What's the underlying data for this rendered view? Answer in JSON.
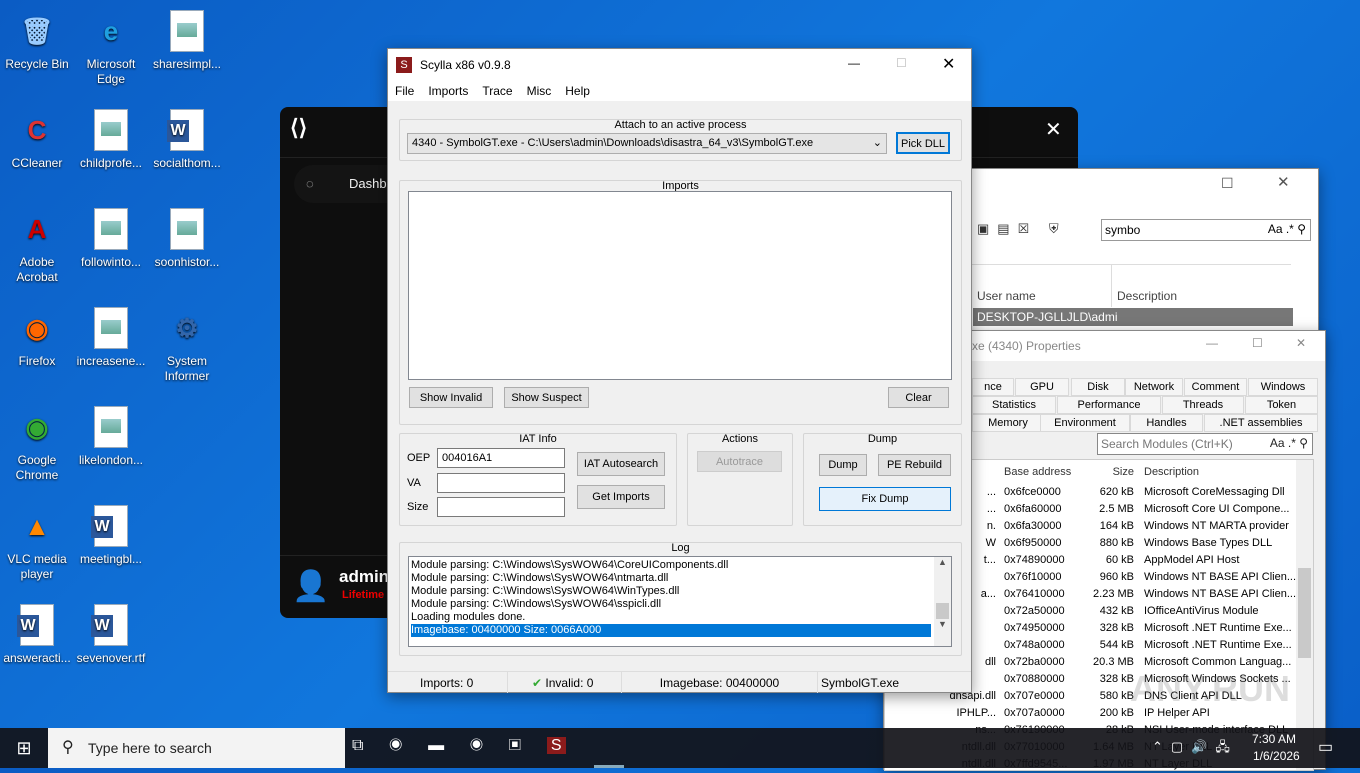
{
  "desktop": {
    "icons": [
      {
        "label": "Recycle Bin",
        "glyph": "🗑"
      },
      {
        "label": "Microsoft Edge",
        "glyph": "e"
      },
      {
        "label": "sharesimpl...",
        "glyph": "doc"
      },
      {
        "label": "CCleaner",
        "glyph": "C"
      },
      {
        "label": "childprofe...",
        "glyph": "doc"
      },
      {
        "label": "socialthom...",
        "glyph": "W"
      },
      {
        "label": "Adobe Acrobat",
        "glyph": "A"
      },
      {
        "label": "followinto...",
        "glyph": "doc"
      },
      {
        "label": "soonhistor...",
        "glyph": "doc"
      },
      {
        "label": "Firefox",
        "glyph": "ff"
      },
      {
        "label": "increasene...",
        "glyph": "doc"
      },
      {
        "label": "System Informer",
        "glyph": "⚙"
      },
      {
        "label": "Google Chrome",
        "glyph": "chrome"
      },
      {
        "label": "likelondon...",
        "glyph": "doc"
      },
      {
        "label": "VLC media player",
        "glyph": "vlc"
      },
      {
        "label": "meetingbl...",
        "glyph": "W"
      },
      {
        "label": "answeracti...",
        "glyph": "W"
      },
      {
        "label": "sevenover.rtf",
        "glyph": "W"
      }
    ]
  },
  "dark_app": {
    "nav_item": "Dashb",
    "user": "admin",
    "plan": "Lifetime"
  },
  "search_window": {
    "search_value": "symbo",
    "case_label": "Aa",
    "regex_label": ".*",
    "col_user": "User name",
    "col_desc": "Description",
    "row_user": "DESKTOP-JGLLJLD\\admi"
  },
  "props_window": {
    "title": "xe (4340) Properties",
    "tabs_row1": [
      "nce",
      "GPU",
      "Disk",
      "Network",
      "Comment",
      "Windows"
    ],
    "tabs_row2": [
      "Statistics",
      "Performance",
      "Threads",
      "Token"
    ],
    "tabs_row3": [
      "Memory",
      "Environment",
      "Handles",
      ".NET assemblies"
    ],
    "search_placeholder": "Search Modules (Ctrl+K)",
    "columns": [
      "Base address",
      "Size",
      "Description"
    ],
    "rows": [
      {
        "name": "...",
        "base": "0x6fce0000",
        "size": "620 kB",
        "desc": "Microsoft CoreMessaging Dll"
      },
      {
        "name": "...",
        "base": "0x6fa60000",
        "size": "2.5 MB",
        "desc": "Microsoft Core UI Compone..."
      },
      {
        "name": "n.",
        "base": "0x6fa30000",
        "size": "164 kB",
        "desc": "Windows NT MARTA provider"
      },
      {
        "name": "W",
        "base": "0x6f950000",
        "size": "880 kB",
        "desc": "Windows Base Types DLL"
      },
      {
        "name": "t...",
        "base": "0x74890000",
        "size": "60 kB",
        "desc": "AppModel API Host"
      },
      {
        "name": "",
        "base": "0x76f10000",
        "size": "960 kB",
        "desc": "Windows NT BASE API Clien..."
      },
      {
        "name": "a...",
        "base": "0x76410000",
        "size": "2.23 MB",
        "desc": "Windows NT BASE API Clien..."
      },
      {
        "name": "",
        "base": "0x72a50000",
        "size": "432 kB",
        "desc": "IOfficeAntiVirus Module"
      },
      {
        "name": "",
        "base": "0x74950000",
        "size": "328 kB",
        "desc": "Microsoft .NET Runtime Exe..."
      },
      {
        "name": "",
        "base": "0x748a0000",
        "size": "544 kB",
        "desc": "Microsoft .NET Runtime Exe..."
      },
      {
        "name": "dll",
        "base": "0x72ba0000",
        "size": "20.3 MB",
        "desc": "Microsoft Common Languag..."
      },
      {
        "name": "",
        "base": "0x70880000",
        "size": "328 kB",
        "desc": "Microsoft Windows Sockets ..."
      },
      {
        "name": "dnsapi.dll",
        "base": "0x707e0000",
        "size": "580 kB",
        "desc": "DNS Client API DLL"
      },
      {
        "name": "IPHLP...",
        "base": "0x707a0000",
        "size": "200 kB",
        "desc": "IP Helper API"
      },
      {
        "name": "ns...",
        "base": "0x76190000",
        "size": "28 kB",
        "desc": "NSI User-mode interface DLL"
      },
      {
        "name": "ntdll.dll",
        "base": "0x77010000",
        "size": "1.64 MB",
        "desc": "NT Layer DLL"
      },
      {
        "name": "ntdll.dll",
        "base": "0x7ffd9545...",
        "size": "1.97 MB",
        "desc": "NT Layer DLL"
      }
    ]
  },
  "scylla": {
    "title": "Scylla x86 v0.9.8",
    "menu": [
      "File",
      "Imports",
      "Trace",
      "Misc",
      "Help"
    ],
    "attach_label": "Attach to an active process",
    "process": "4340 - SymbolGT.exe - C:\\Users\\admin\\Downloads\\disastra_64_v3\\SymbolGT.exe",
    "pick_dll": "Pick DLL",
    "imports_label": "Imports",
    "show_invalid": "Show Invalid",
    "show_suspect": "Show Suspect",
    "clear": "Clear",
    "iat_label": "IAT Info",
    "oep_label": "OEP",
    "oep_value": "004016A1",
    "va_label": "VA",
    "size_label": "Size",
    "iat_autosearch": "IAT Autosearch",
    "get_imports": "Get Imports",
    "actions_label": "Actions",
    "autotrace": "Autotrace",
    "dump_label": "Dump",
    "dump": "Dump",
    "pe_rebuild": "PE Rebuild",
    "fix_dump": "Fix Dump",
    "log_label": "Log",
    "log": [
      "Module parsing: C:\\Windows\\SysWOW64\\CoreUIComponents.dll",
      "Module parsing: C:\\Windows\\SysWOW64\\ntmarta.dll",
      "Module parsing: C:\\Windows\\SysWOW64\\WinTypes.dll",
      "Module parsing: C:\\Windows\\SysWOW64\\sspicli.dll",
      "Loading modules done.",
      "Imagebase: 00400000 Size: 0066A000"
    ],
    "status": {
      "imports": "Imports: 0",
      "invalid": "Invalid: 0",
      "imagebase": "Imagebase: 00400000",
      "file": "SymbolGT.exe"
    }
  },
  "taskbar": {
    "search_placeholder": "Type here to search",
    "time": "7:30 AM",
    "date": "1/6/2026"
  },
  "watermark": "ANY.RUN"
}
